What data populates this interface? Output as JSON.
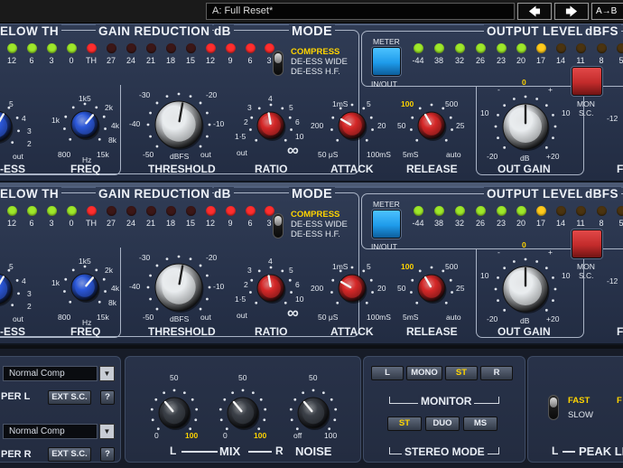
{
  "host": {
    "preset": "A: Full Reset*",
    "prev_label": "🡄",
    "next_label": "🡆",
    "ab_label": "A→B"
  },
  "strips": [
    {
      "below_th_header": "ELOW TH",
      "gr_header": "GAIN REDUCTION",
      "gr_unit": "dB",
      "mode_header": "MODE",
      "output_header": "OUTPUT LEVEL",
      "output_unit": "dBFS",
      "below_th_ticks": [
        "12",
        "6",
        "3",
        "0"
      ],
      "gr_ticks": [
        "TH",
        "27",
        "24",
        "21",
        "18",
        "15",
        "12",
        "9",
        "6",
        "3"
      ],
      "output_ticks": [
        "-44",
        "38",
        "32",
        "26",
        "23",
        "20",
        "17",
        "14",
        "11",
        "8",
        "5"
      ],
      "mode_options": [
        "COMPRESS",
        "DE-ESS WIDE",
        "DE-ESS H.F."
      ],
      "mode_selected": "COMPRESS",
      "meter_label": "METER",
      "meter_sub": "IN/OUT",
      "mon_label": "MON",
      "mon_sub": "S.C.",
      "ess_label": "-ESS",
      "ess_ticks": [
        "5",
        "4",
        "3",
        "2",
        "out"
      ],
      "freq_label": "FREQ",
      "freq_ticks": [
        "1k5",
        "2k",
        "1k",
        "4k",
        "8k",
        "800",
        "Hz",
        "15k"
      ],
      "threshold_label": "THRESHOLD",
      "threshold_ticks": [
        "-30",
        "-20",
        "-40",
        "-10",
        "-50",
        "dBFS",
        "out"
      ],
      "ratio_label": "RATIO",
      "ratio_ticks": [
        "4",
        "3",
        "5",
        "2",
        "6",
        "1·5",
        "10",
        "out",
        "∞"
      ],
      "attack_label": "ATTACK",
      "attack_ticks": [
        "1mS",
        "5",
        "200",
        "20",
        "50 μS",
        "100mS"
      ],
      "release_label": "RELEASE",
      "release_ticks": [
        "100",
        "500",
        "50",
        "25",
        "5mS",
        "auto"
      ],
      "outgain_label": "OUT GAIN",
      "outgain_ticks": [
        "0",
        "-",
        "+",
        "10",
        "10",
        "-20",
        "dB",
        "+20"
      ],
      "right_ticks": [
        "-12"
      ],
      "right_label": "F"
    },
    {
      "below_th_header": "ELOW TH",
      "gr_header": "GAIN REDUCTION",
      "gr_unit": "dB",
      "mode_header": "MODE",
      "output_header": "OUTPUT LEVEL",
      "output_unit": "dBFS",
      "below_th_ticks": [
        "12",
        "6",
        "3",
        "0"
      ],
      "gr_ticks": [
        "TH",
        "27",
        "24",
        "21",
        "18",
        "15",
        "12",
        "9",
        "6",
        "3"
      ],
      "output_ticks": [
        "-44",
        "38",
        "32",
        "26",
        "23",
        "20",
        "17",
        "14",
        "11",
        "8",
        "5"
      ],
      "mode_options": [
        "COMPRESS",
        "DE-ESS WIDE",
        "DE-ESS H.F."
      ],
      "mode_selected": "COMPRESS",
      "meter_label": "METER",
      "meter_sub": "IN/OUT",
      "mon_label": "MON",
      "mon_sub": "S.C.",
      "ess_label": "-ESS",
      "ess_ticks": [
        "5",
        "4",
        "3",
        "2",
        "out"
      ],
      "freq_label": "FREQ",
      "freq_ticks": [
        "1k5",
        "2k",
        "1k",
        "4k",
        "8k",
        "800",
        "Hz",
        "15k"
      ],
      "threshold_label": "THRESHOLD",
      "threshold_ticks": [
        "-30",
        "-20",
        "-40",
        "-10",
        "-50",
        "dBFS",
        "out"
      ],
      "ratio_label": "RATIO",
      "ratio_ticks": [
        "4",
        "3",
        "5",
        "2",
        "6",
        "1·5",
        "10",
        "out",
        "∞"
      ],
      "attack_label": "ATTACK",
      "attack_ticks": [
        "1mS",
        "5",
        "200",
        "20",
        "50 μS",
        "100mS"
      ],
      "release_label": "RELEASE",
      "release_ticks": [
        "100",
        "500",
        "50",
        "25",
        "5mS",
        "auto"
      ],
      "outgain_label": "OUT GAIN",
      "outgain_ticks": [
        "0",
        "-",
        "+",
        "10",
        "10",
        "-20",
        "dB",
        "+20"
      ],
      "right_ticks": [
        "-12"
      ],
      "right_label": "F"
    }
  ],
  "bottom": {
    "comp_l": {
      "preset": "Normal Comp",
      "label": "PER  L",
      "sc_button": "EXT S.C.",
      "help": "?"
    },
    "comp_r": {
      "preset": "Normal Comp",
      "label": "PER  R",
      "sc_button": "EXT S.C.",
      "help": "?"
    },
    "mix": {
      "label": "MIX",
      "l_label": "L",
      "r_label": "R",
      "noise_label": "NOISE",
      "l_ticks": [
        "50",
        "0",
        "100"
      ],
      "r_ticks": [
        "50",
        "0",
        "100"
      ],
      "noise_ticks": [
        "50",
        "off",
        "100"
      ]
    },
    "monitor": {
      "label": "MONITOR",
      "buttons": [
        "L",
        "MONO",
        "ST",
        "R"
      ],
      "active": "ST"
    },
    "stereo_mode": {
      "label": "STEREO MODE",
      "buttons": [
        "ST",
        "DUO",
        "MS"
      ],
      "active": "ST"
    },
    "peak_limit": {
      "label": "PEAK LIM",
      "fast": "FAST",
      "slow": "SLOW",
      "l_label": "L",
      "extra": "F"
    }
  },
  "colors": {
    "led_green": "#9ee82a",
    "led_red": "#ff2e2e",
    "led_off_red": "#3c1717",
    "led_yellow": "#ffcb1c",
    "led_off_amber": "#4b3410",
    "meter_button": "#1e9bea",
    "mon_button": "#c22b2b",
    "accent_yellow": "#ffd400"
  }
}
